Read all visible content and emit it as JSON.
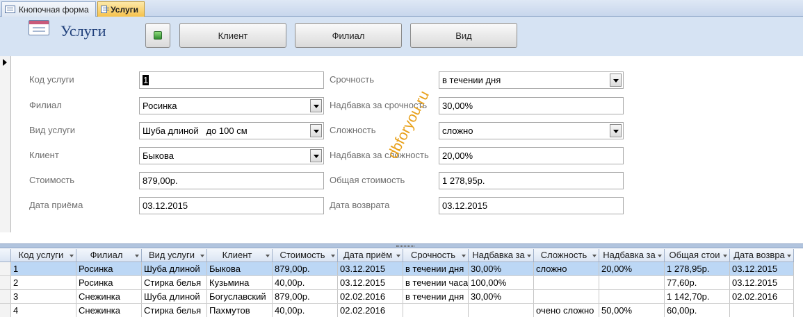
{
  "tabs": [
    {
      "label": "Кнопочная форма",
      "active": false
    },
    {
      "label": "Услуги",
      "active": true
    }
  ],
  "header": {
    "title": "Услуги",
    "buttons": [
      "Клиент",
      "Филиал",
      "Вид"
    ]
  },
  "form": {
    "left": [
      {
        "label": "Код услуги",
        "value": "1",
        "type": "text"
      },
      {
        "label": "Филиал",
        "value": "Росинка",
        "type": "combo"
      },
      {
        "label": "Вид услуги",
        "value": "Шуба длиной   до 100 см",
        "type": "combo"
      },
      {
        "label": "Клиент",
        "value": "Быкова",
        "type": "combo"
      },
      {
        "label": "Стоимость",
        "value": "879,00р.",
        "type": "text"
      },
      {
        "label": "Дата приёма",
        "value": "03.12.2015",
        "type": "text"
      }
    ],
    "right": [
      {
        "label": "Срочность",
        "value": "в течении дня",
        "type": "combo"
      },
      {
        "label": "Надбавка за срочность",
        "value": "30,00%",
        "type": "text"
      },
      {
        "label": "Сложность",
        "value": "сложно",
        "type": "combo"
      },
      {
        "label": "Надбавка за сложность",
        "value": "20,00%",
        "type": "text"
      },
      {
        "label": "Общая стоимость",
        "value": "1 278,95р.",
        "type": "text"
      },
      {
        "label": "Дата возврата",
        "value": "03.12.2015",
        "type": "text"
      }
    ]
  },
  "watermark": "dbforyou.ru",
  "datasheet": {
    "columns": [
      "Код услуги",
      "Филиал",
      "Вид услуги",
      "Клиент",
      "Стоимость",
      "Дата приём",
      "Срочность",
      "Надбавка за",
      "Сложность",
      "Надбавка за",
      "Общая стои",
      "Дата возвра"
    ],
    "rows": [
      [
        "1",
        "Росинка",
        "Шуба длиной",
        "Быкова",
        "879,00р.",
        "03.12.2015",
        "в течении дня",
        "30,00%",
        "сложно",
        "20,00%",
        "1 278,95р.",
        "03.12.2015"
      ],
      [
        "2",
        "Росинка",
        "Стирка  белья",
        "Кузьмина",
        "40,00р.",
        "03.12.2015",
        "в течении часа",
        "100,00%",
        "",
        "",
        "77,60р.",
        "03.12.2015"
      ],
      [
        "3",
        "Снежинка",
        "Шуба длиной",
        "Богуславский",
        "879,00р.",
        "02.02.2016",
        "в течении дня",
        "30,00%",
        "",
        "",
        "1 142,70р.",
        "02.02.2016"
      ],
      [
        "4",
        "Снежинка",
        "Стирка  белья",
        "Пахмутов",
        "40,00р.",
        "02.02.2016",
        "",
        "",
        "очено сложно",
        "50,00%",
        "60,00р.",
        ""
      ]
    ]
  }
}
